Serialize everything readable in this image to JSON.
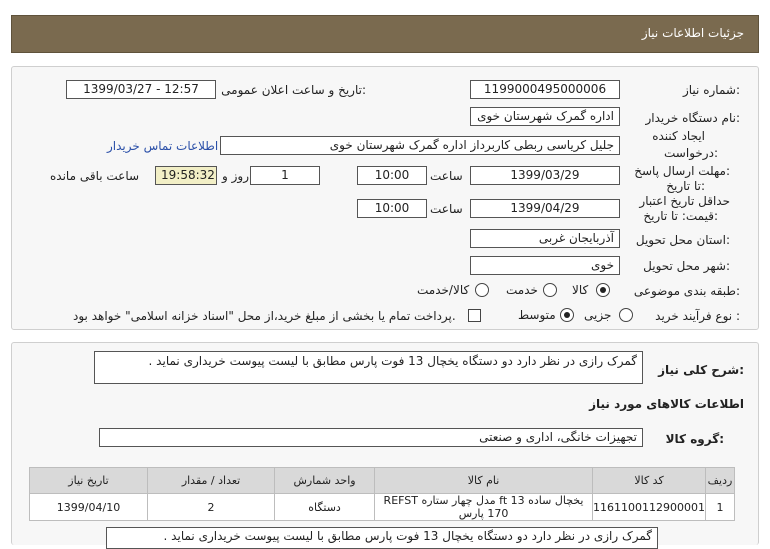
{
  "header": {
    "title": "جزئیات اطلاعات نیاز"
  },
  "form": {
    "need_number_label": "شماره نیاز:",
    "need_number": "1199000495000006",
    "announce_label": "تاریخ و ساعت اعلان عمومی:",
    "announce_value": "1399/03/27 - 12:57",
    "buyer_org_label": "نام دستگاه خریدار:",
    "buyer_org": "اداره گمرک شهرستان خوی",
    "creator_label_1": "ایجاد کننده",
    "creator_label_2": "درخواست:",
    "creator": "جلیل کریاسی ربطی کاربرداز اداره گمرک شهرستان خوی",
    "contact_link": "اطلاعات تماس خریدار",
    "deadline_label_1": "مهلت ارسال پاسخ:",
    "deadline_label_2": "تا تاریخ:",
    "deadline_date": "1399/03/29",
    "time_label": "ساعت",
    "deadline_time": "10:00",
    "days_value": "1",
    "days_label": "روز و",
    "remaining_time": "19:58:32",
    "remaining_label": "ساعت باقی مانده",
    "validity_label_1": "حداقل تاریخ اعتبار",
    "validity_label_2": "قیمت: تا تاریخ:",
    "validity_date": "1399/04/29",
    "validity_time": "10:00",
    "province_label": "استان محل تحویل:",
    "province": "آذربایجان غربی",
    "city_label": "شهر محل تحویل:",
    "city": "خوی",
    "category_label": "طبقه بندی موضوعی:",
    "category_options": [
      "کالا",
      "خدمت",
      "کالا/خدمت"
    ],
    "process_label": "نوع فرآیند خرید :",
    "process_options": [
      "جزیی",
      "متوسط"
    ],
    "payment_note": "پرداخت تمام یا بخشی از مبلغ خرید،از محل \"اسناد خزانه اسلامی\" خواهد بود."
  },
  "summary": {
    "label": "شرح کلی نیاز:",
    "text": "گمرک رازی در نظر دارد دو دستگاه یخچال 13 فوت پارس مطابق با لیست پیوست خریداری نماید ."
  },
  "items": {
    "section_title": "اطلاعات کالاهای مورد نیاز",
    "group_label": "گروه کالا:",
    "group_value": "تجهیزات خانگی، اداری و صنعتی",
    "columns": [
      "ردیف",
      "کد کالا",
      "نام کالا",
      "واحد شمارش",
      "تعداد / مقدار",
      "تاریخ نیاز"
    ],
    "rows": [
      [
        "1",
        "1161100112900001",
        "یخچال ساده 13 ft مدل چهار ستاره REFST 170 پارس",
        "دستگاه",
        "2",
        "1399/04/10"
      ]
    ],
    "footer_text": "گمرک رازی در نظر دارد دو دستگاه یخچال 13 فوت پارس مطابق با لیست پیوست خریداری نماید ."
  }
}
